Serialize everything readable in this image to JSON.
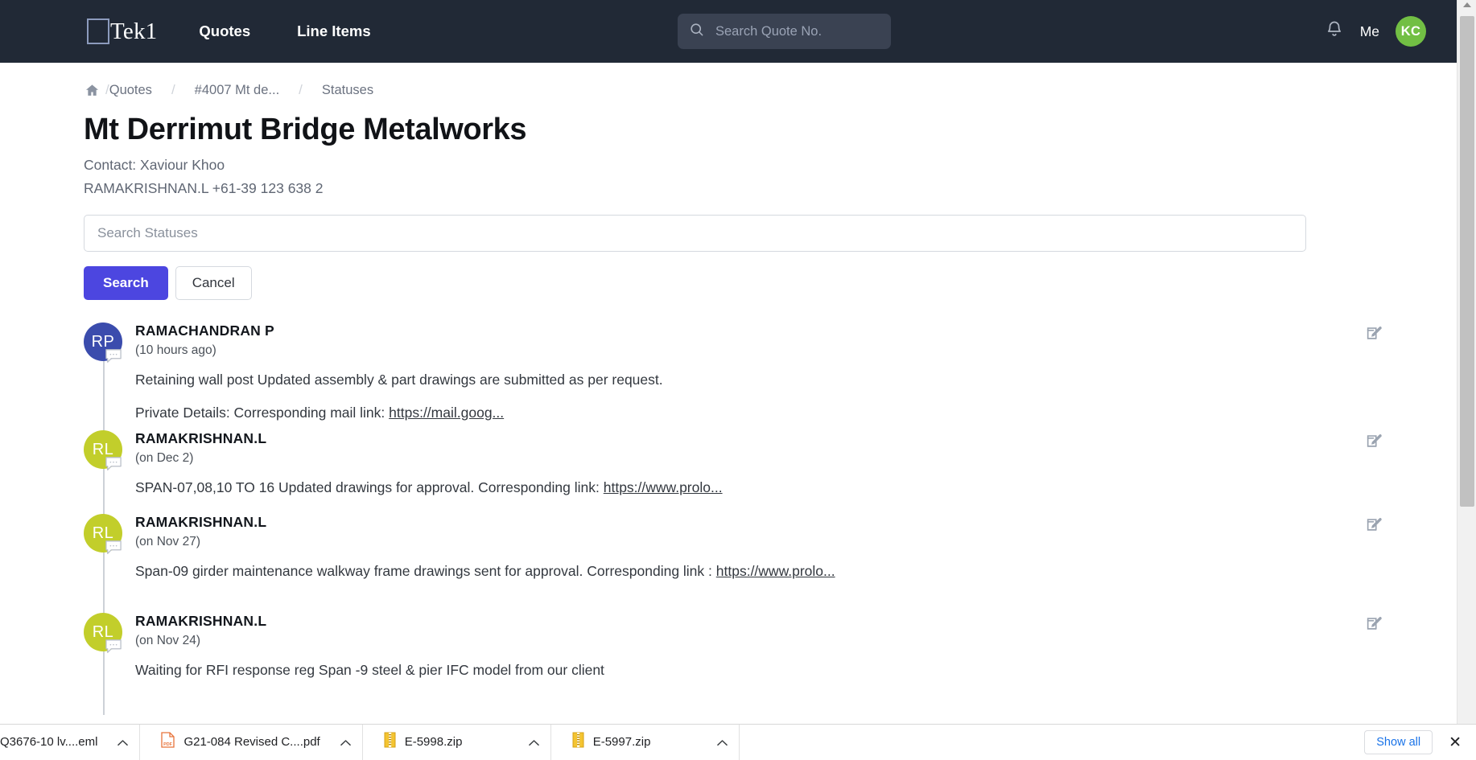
{
  "header": {
    "brand": "Tek1",
    "brand_icon": "square-logo-icon",
    "nav": [
      {
        "label": "Quotes"
      },
      {
        "label": "Line Items"
      }
    ],
    "search": {
      "placeholder": "Search Quote No.",
      "value": "",
      "icon": "search-icon"
    },
    "notification_icon": "bell-icon",
    "me_label": "Me",
    "avatar_initials": "KC",
    "avatar_color": "#72bf44",
    "background": "#212936"
  },
  "breadcrumb": {
    "home_icon": "home-icon",
    "separator": "/",
    "items": [
      {
        "label": "Quotes"
      },
      {
        "label": "#4007 Mt de..."
      },
      {
        "label": "Statuses"
      }
    ]
  },
  "page": {
    "title": "Mt Derrimut Bridge Metalworks",
    "contact": "Contact: Xaviour Khoo",
    "phone": "RAMAKRISHNAN.L +61-39 123 638 2"
  },
  "search_form": {
    "placeholder": "Search Statuses",
    "value": "",
    "search_button": "Search",
    "cancel_button": "Cancel",
    "primary_color": "#4c46e0"
  },
  "statuses": [
    {
      "initials": "RP",
      "avatar_color": "#3b4cad",
      "name": "RAMACHANDRAN P",
      "time": "(10 hours ago)",
      "text": "Retaining wall post Updated assembly & part drawings are submitted as per request.",
      "text2_prefix": "Private Details: Corresponding mail link: ",
      "text2_link": "https://mail.goog...",
      "edit_icon": "edit-icon"
    },
    {
      "initials": "RL",
      "avatar_color": "#c2ce2b",
      "name": "RAMAKRISHNAN.L",
      "time": "(on Dec 2)",
      "text_prefix": "SPAN-07,08,10 TO 16 Updated drawings for approval. Corresponding link: ",
      "text_link": "https://www.prolo...",
      "edit_icon": "edit-icon"
    },
    {
      "initials": "RL",
      "avatar_color": "#c2ce2b",
      "name": "RAMAKRISHNAN.L",
      "time": "(on Nov 27)",
      "text_prefix": "Span-09 girder maintenance walkway frame drawings sent for approval. Corresponding link : ",
      "text_link": "https://www.prolo...",
      "edit_icon": "edit-icon"
    },
    {
      "initials": "RL",
      "avatar_color": "#c2ce2b",
      "name": "RAMAKRISHNAN.L",
      "time": "(on Nov 24)",
      "text": "Waiting for RFI response reg Span -9 steel & pier IFC model from our client",
      "edit_icon": "edit-icon"
    }
  ],
  "downloads": {
    "items": [
      {
        "name": "Q3676-10 lv....eml",
        "icon": "eml-file-icon"
      },
      {
        "name": "G21-084 Revised C....pdf",
        "icon": "pdf-file-icon"
      },
      {
        "name": "E-5998.zip",
        "icon": "zip-file-icon"
      },
      {
        "name": "E-5997.zip",
        "icon": "zip-file-icon"
      }
    ],
    "show_all": "Show all",
    "close_icon": "close-icon",
    "chevron": "chevron-up-icon"
  }
}
